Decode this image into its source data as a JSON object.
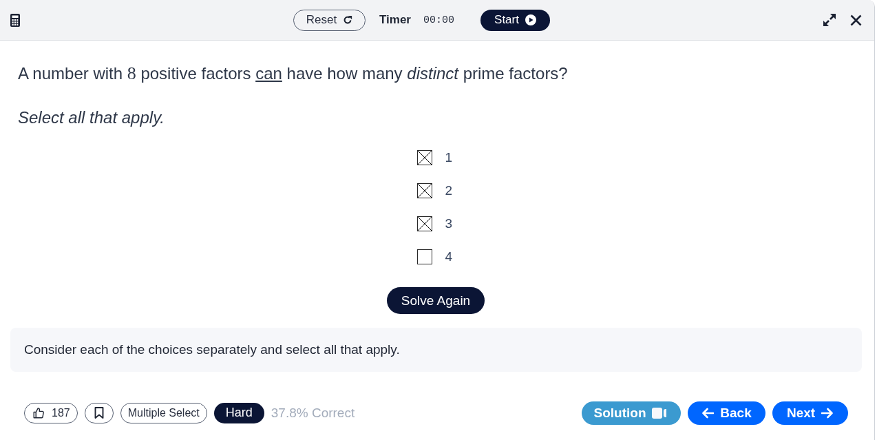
{
  "toolbar": {
    "reset_button": "Reset",
    "timer_label": "Timer",
    "timer_value": "00:00",
    "start_button": "Start"
  },
  "question": {
    "segments": [
      {
        "kind": "plain",
        "text": "A number with "
      },
      {
        "kind": "math",
        "text": "8"
      },
      {
        "kind": "plain",
        "text": " positive factors "
      },
      {
        "kind": "underline",
        "text": "can"
      },
      {
        "kind": "plain",
        "text": " have how many "
      },
      {
        "kind": "italic",
        "text": "distinct"
      },
      {
        "kind": "plain",
        "text": " prime factors?"
      }
    ],
    "instruction": "Select all that apply."
  },
  "choices": [
    {
      "label": "1",
      "checked": true
    },
    {
      "label": "2",
      "checked": true
    },
    {
      "label": "3",
      "checked": true
    },
    {
      "label": "4",
      "checked": false
    }
  ],
  "solve_button": "Solve Again",
  "hint": "Consider each of the choices separately and select all that apply.",
  "footer": {
    "likes": "187",
    "question_type": "Multiple Select",
    "difficulty": "Hard",
    "percent_correct": "37.8% Correct",
    "solution_button": "Solution",
    "back_button": "Back",
    "next_button": "Next"
  }
}
